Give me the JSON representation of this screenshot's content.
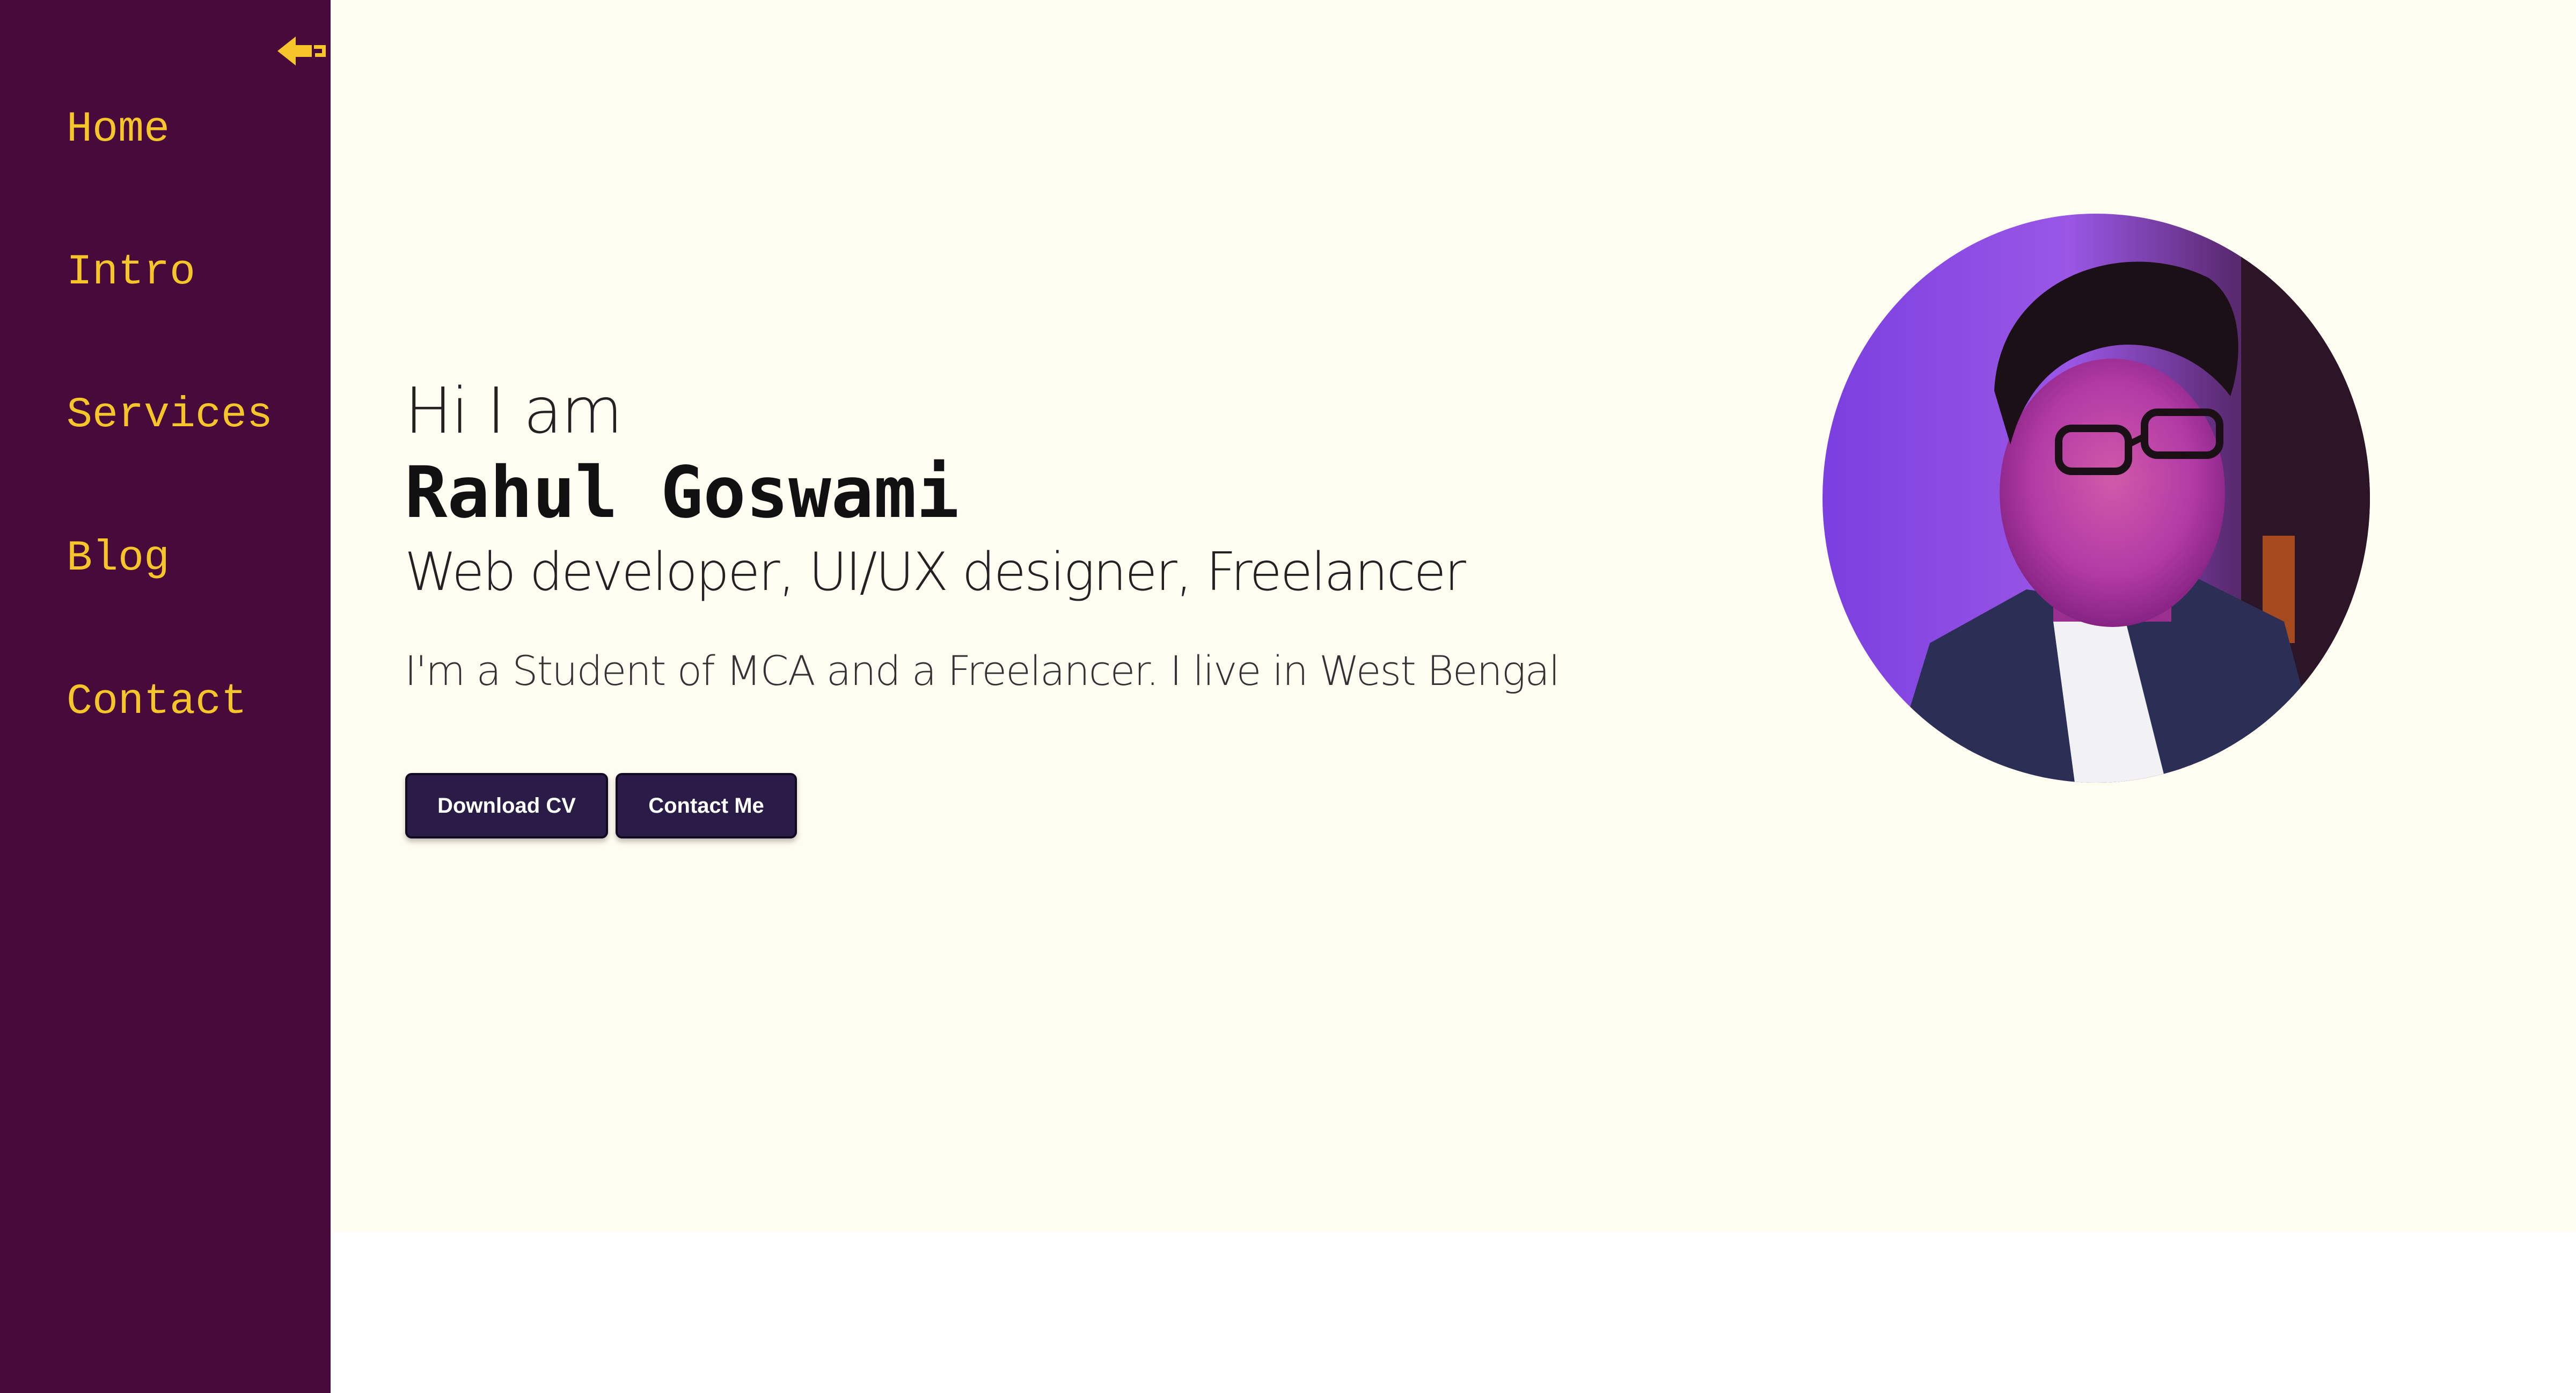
{
  "sidebar": {
    "collapse_icon": "arrow-left-icon",
    "items": [
      {
        "label": "Home"
      },
      {
        "label": "Intro"
      },
      {
        "label": "Services"
      },
      {
        "label": "Blog"
      },
      {
        "label": "Contact"
      }
    ]
  },
  "hero": {
    "greeting": "Hi I am",
    "name": "Rahul Goswami",
    "roles": "Web developer, UI/UX designer, Freelancer",
    "bio": "I'm a Student of MCA and a Freelancer. I live in West Bengal",
    "buttons": {
      "download_cv": "Download CV",
      "contact_me": "Contact Me"
    }
  },
  "colors": {
    "sidebar_bg": "#470a3b",
    "nav_text": "#f6c52a",
    "hero_bg": "#fffcf2",
    "button_bg": "#2a1b47"
  }
}
